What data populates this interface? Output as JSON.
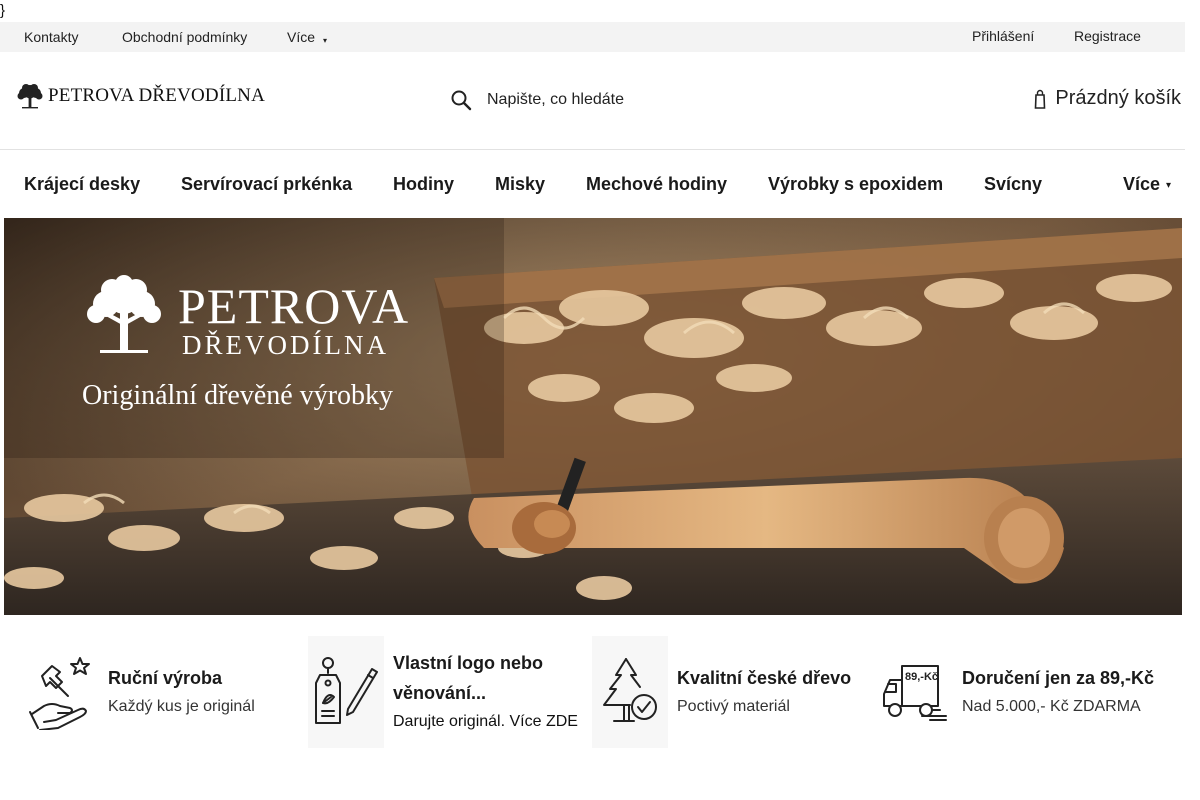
{
  "stray_text": "}",
  "topbar": {
    "links": [
      "Kontakty",
      "Obchodní podmínky"
    ],
    "more_label": "Více",
    "login_label": "Přihlášení",
    "register_label": "Registrace"
  },
  "header": {
    "logo_text": "PETROVA DŘEVODÍLNA",
    "search_placeholder": "Napište, co hledáte",
    "cart_label": "Prázdný košík"
  },
  "categories": [
    "Krájecí desky",
    "Servírovací prkénka",
    "Hodiny",
    "Misky",
    "Mechové hodiny",
    "Výrobky s epoxidem",
    "Svícny"
  ],
  "categories_more_label": "Více",
  "hero": {
    "title_line1": "PETROVA",
    "title_line2": "DŘEVODÍLNA",
    "tagline": "Originální dřevěné výrobky"
  },
  "features": [
    {
      "title": "Ruční výroba",
      "subtitle": "Každý kus je originál",
      "icon": "handmade-hammer-hand-icon"
    },
    {
      "title": "Vlastní logo nebo věnování...",
      "subtitle": "Darujte originál. Více ZDE",
      "icon": "tag-pencil-icon"
    },
    {
      "title": "Kvalitní české dřevo",
      "subtitle": "Poctivý materiál",
      "icon": "tree-check-icon"
    },
    {
      "title": "Doručení jen za 89,-Kč",
      "subtitle": "Nad 5.000,- Kč ZDARMA",
      "icon": "delivery-van-icon",
      "icon_text": "89,-Kč"
    }
  ],
  "colors": {
    "topbar_bg": "#f3f3f3",
    "text": "#1a1a1a",
    "divider": "#e2e2e2"
  }
}
